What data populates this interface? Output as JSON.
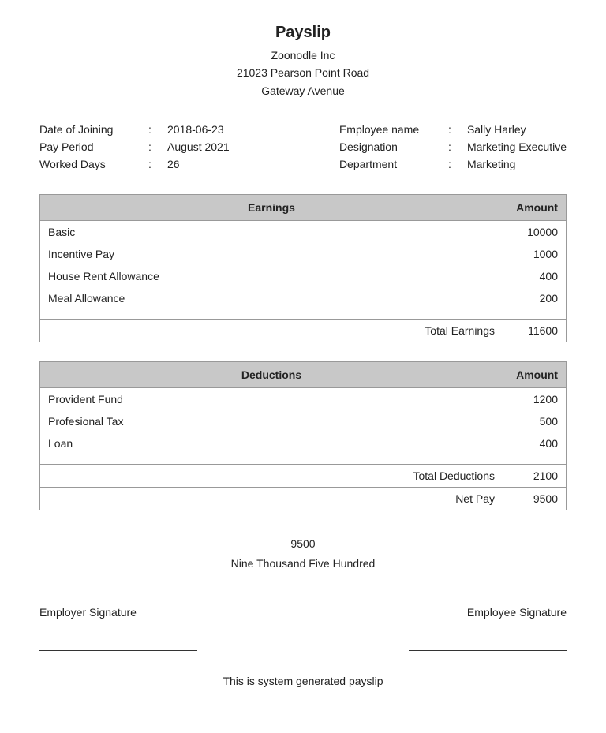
{
  "header": {
    "title": "Payslip",
    "company": "Zoonodle Inc",
    "address_line1": "21023 Pearson Point Road",
    "address_line2": "Gateway Avenue"
  },
  "employee_info": {
    "left": {
      "date_of_joining_label": "Date of Joining",
      "date_of_joining_value": "2018-06-23",
      "pay_period_label": "Pay Period",
      "pay_period_value": "August 2021",
      "worked_days_label": "Worked Days",
      "worked_days_value": "26"
    },
    "right": {
      "employee_name_label": "Employee name",
      "employee_name_value": "Sally Harley",
      "designation_label": "Designation",
      "designation_value": "Marketing Executive",
      "department_label": "Department",
      "department_value": "Marketing"
    }
  },
  "earnings": {
    "table_header_label": "Earnings",
    "table_header_amount": "Amount",
    "rows": [
      {
        "label": "Basic",
        "amount": "10000"
      },
      {
        "label": "Incentive Pay",
        "amount": "1000"
      },
      {
        "label": "House Rent Allowance",
        "amount": "400"
      },
      {
        "label": "Meal Allowance",
        "amount": "200"
      }
    ],
    "total_label": "Total Earnings",
    "total_value": "11600"
  },
  "deductions": {
    "table_header_label": "Deductions",
    "table_header_amount": "Amount",
    "rows": [
      {
        "label": "Provident Fund",
        "amount": "1200"
      },
      {
        "label": "Profesional Tax",
        "amount": "500"
      },
      {
        "label": "Loan",
        "amount": "400"
      }
    ],
    "total_label": "Total Deductions",
    "total_value": "2100",
    "netpay_label": "Net Pay",
    "netpay_value": "9500"
  },
  "summary": {
    "net_amount": "9500",
    "net_words": "Nine Thousand Five Hundred"
  },
  "signatures": {
    "employer_label": "Employer Signature",
    "employee_label": "Employee Signature"
  },
  "footer": {
    "text": "This is system generated payslip"
  },
  "colon": ":"
}
